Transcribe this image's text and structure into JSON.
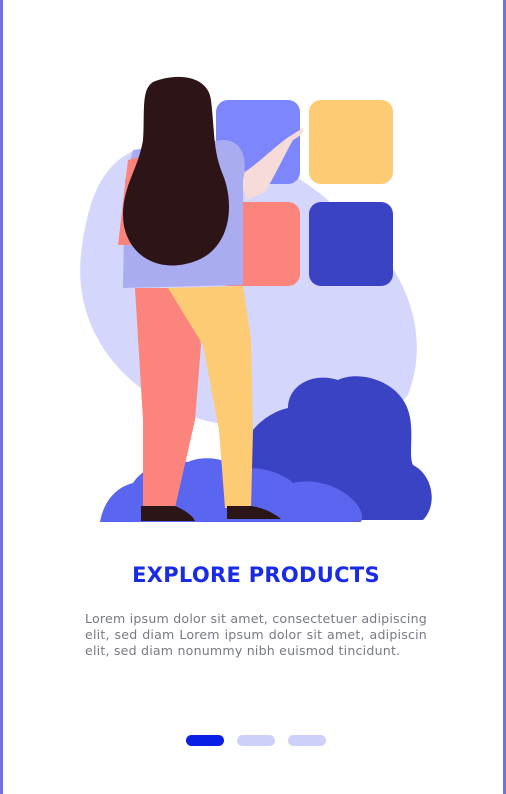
{
  "onboarding": {
    "title": "EXPLORE PRODUCTS",
    "description": "Lorem ipsum dolor sit amet, consectetuer adipiscing elit, sed diam Lorem ipsum dolor sit amet, adipiscin elit, sed diam nonummy nibh euismod tincidunt.",
    "illustration": "woman-arranging-product-tiles-illustration",
    "pagination": {
      "total": 3,
      "current": 1
    }
  },
  "colors": {
    "accent": "#1a2be6",
    "active_dot": "#0a1fe6",
    "inactive_dot": "#cdd1fa",
    "border": "#6b72e8",
    "text": "#777a84"
  }
}
